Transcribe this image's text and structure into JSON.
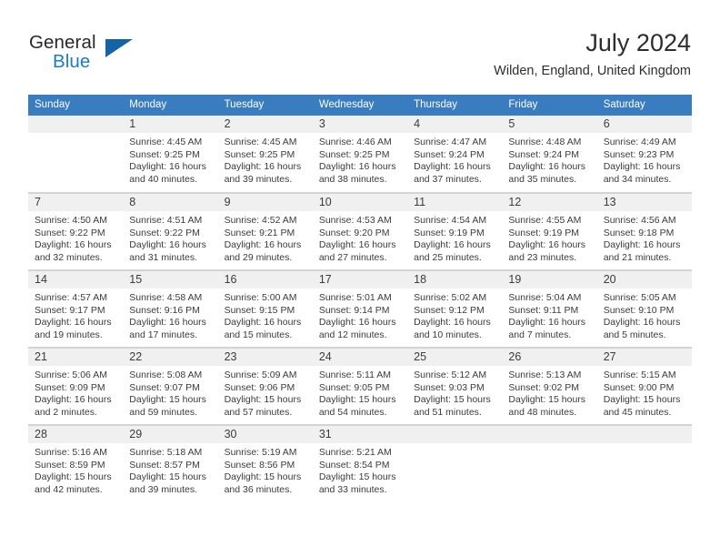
{
  "brand": {
    "line1": "General",
    "line2": "Blue",
    "triangle_color": "#1464a5",
    "blue_color": "#1a7cc4"
  },
  "header": {
    "title": "July 2024",
    "location": "Wilden, England, United Kingdom"
  },
  "theme": {
    "header_bar": "#3a7cc0",
    "daynum_band": "#f0f0f0",
    "grid_line": "#cfd3d6",
    "text": "#3b3b3b"
  },
  "weekdays": [
    "Sunday",
    "Monday",
    "Tuesday",
    "Wednesday",
    "Thursday",
    "Friday",
    "Saturday"
  ],
  "weeks": [
    [
      {
        "day": "",
        "sunrise": "",
        "sunset": "",
        "daylight1": "",
        "daylight2": ""
      },
      {
        "day": "1",
        "sunrise": "Sunrise: 4:45 AM",
        "sunset": "Sunset: 9:25 PM",
        "daylight1": "Daylight: 16 hours",
        "daylight2": "and 40 minutes."
      },
      {
        "day": "2",
        "sunrise": "Sunrise: 4:45 AM",
        "sunset": "Sunset: 9:25 PM",
        "daylight1": "Daylight: 16 hours",
        "daylight2": "and 39 minutes."
      },
      {
        "day": "3",
        "sunrise": "Sunrise: 4:46 AM",
        "sunset": "Sunset: 9:25 PM",
        "daylight1": "Daylight: 16 hours",
        "daylight2": "and 38 minutes."
      },
      {
        "day": "4",
        "sunrise": "Sunrise: 4:47 AM",
        "sunset": "Sunset: 9:24 PM",
        "daylight1": "Daylight: 16 hours",
        "daylight2": "and 37 minutes."
      },
      {
        "day": "5",
        "sunrise": "Sunrise: 4:48 AM",
        "sunset": "Sunset: 9:24 PM",
        "daylight1": "Daylight: 16 hours",
        "daylight2": "and 35 minutes."
      },
      {
        "day": "6",
        "sunrise": "Sunrise: 4:49 AM",
        "sunset": "Sunset: 9:23 PM",
        "daylight1": "Daylight: 16 hours",
        "daylight2": "and 34 minutes."
      }
    ],
    [
      {
        "day": "7",
        "sunrise": "Sunrise: 4:50 AM",
        "sunset": "Sunset: 9:22 PM",
        "daylight1": "Daylight: 16 hours",
        "daylight2": "and 32 minutes."
      },
      {
        "day": "8",
        "sunrise": "Sunrise: 4:51 AM",
        "sunset": "Sunset: 9:22 PM",
        "daylight1": "Daylight: 16 hours",
        "daylight2": "and 31 minutes."
      },
      {
        "day": "9",
        "sunrise": "Sunrise: 4:52 AM",
        "sunset": "Sunset: 9:21 PM",
        "daylight1": "Daylight: 16 hours",
        "daylight2": "and 29 minutes."
      },
      {
        "day": "10",
        "sunrise": "Sunrise: 4:53 AM",
        "sunset": "Sunset: 9:20 PM",
        "daylight1": "Daylight: 16 hours",
        "daylight2": "and 27 minutes."
      },
      {
        "day": "11",
        "sunrise": "Sunrise: 4:54 AM",
        "sunset": "Sunset: 9:19 PM",
        "daylight1": "Daylight: 16 hours",
        "daylight2": "and 25 minutes."
      },
      {
        "day": "12",
        "sunrise": "Sunrise: 4:55 AM",
        "sunset": "Sunset: 9:19 PM",
        "daylight1": "Daylight: 16 hours",
        "daylight2": "and 23 minutes."
      },
      {
        "day": "13",
        "sunrise": "Sunrise: 4:56 AM",
        "sunset": "Sunset: 9:18 PM",
        "daylight1": "Daylight: 16 hours",
        "daylight2": "and 21 minutes."
      }
    ],
    [
      {
        "day": "14",
        "sunrise": "Sunrise: 4:57 AM",
        "sunset": "Sunset: 9:17 PM",
        "daylight1": "Daylight: 16 hours",
        "daylight2": "and 19 minutes."
      },
      {
        "day": "15",
        "sunrise": "Sunrise: 4:58 AM",
        "sunset": "Sunset: 9:16 PM",
        "daylight1": "Daylight: 16 hours",
        "daylight2": "and 17 minutes."
      },
      {
        "day": "16",
        "sunrise": "Sunrise: 5:00 AM",
        "sunset": "Sunset: 9:15 PM",
        "daylight1": "Daylight: 16 hours",
        "daylight2": "and 15 minutes."
      },
      {
        "day": "17",
        "sunrise": "Sunrise: 5:01 AM",
        "sunset": "Sunset: 9:14 PM",
        "daylight1": "Daylight: 16 hours",
        "daylight2": "and 12 minutes."
      },
      {
        "day": "18",
        "sunrise": "Sunrise: 5:02 AM",
        "sunset": "Sunset: 9:12 PM",
        "daylight1": "Daylight: 16 hours",
        "daylight2": "and 10 minutes."
      },
      {
        "day": "19",
        "sunrise": "Sunrise: 5:04 AM",
        "sunset": "Sunset: 9:11 PM",
        "daylight1": "Daylight: 16 hours",
        "daylight2": "and 7 minutes."
      },
      {
        "day": "20",
        "sunrise": "Sunrise: 5:05 AM",
        "sunset": "Sunset: 9:10 PM",
        "daylight1": "Daylight: 16 hours",
        "daylight2": "and 5 minutes."
      }
    ],
    [
      {
        "day": "21",
        "sunrise": "Sunrise: 5:06 AM",
        "sunset": "Sunset: 9:09 PM",
        "daylight1": "Daylight: 16 hours",
        "daylight2": "and 2 minutes."
      },
      {
        "day": "22",
        "sunrise": "Sunrise: 5:08 AM",
        "sunset": "Sunset: 9:07 PM",
        "daylight1": "Daylight: 15 hours",
        "daylight2": "and 59 minutes."
      },
      {
        "day": "23",
        "sunrise": "Sunrise: 5:09 AM",
        "sunset": "Sunset: 9:06 PM",
        "daylight1": "Daylight: 15 hours",
        "daylight2": "and 57 minutes."
      },
      {
        "day": "24",
        "sunrise": "Sunrise: 5:11 AM",
        "sunset": "Sunset: 9:05 PM",
        "daylight1": "Daylight: 15 hours",
        "daylight2": "and 54 minutes."
      },
      {
        "day": "25",
        "sunrise": "Sunrise: 5:12 AM",
        "sunset": "Sunset: 9:03 PM",
        "daylight1": "Daylight: 15 hours",
        "daylight2": "and 51 minutes."
      },
      {
        "day": "26",
        "sunrise": "Sunrise: 5:13 AM",
        "sunset": "Sunset: 9:02 PM",
        "daylight1": "Daylight: 15 hours",
        "daylight2": "and 48 minutes."
      },
      {
        "day": "27",
        "sunrise": "Sunrise: 5:15 AM",
        "sunset": "Sunset: 9:00 PM",
        "daylight1": "Daylight: 15 hours",
        "daylight2": "and 45 minutes."
      }
    ],
    [
      {
        "day": "28",
        "sunrise": "Sunrise: 5:16 AM",
        "sunset": "Sunset: 8:59 PM",
        "daylight1": "Daylight: 15 hours",
        "daylight2": "and 42 minutes."
      },
      {
        "day": "29",
        "sunrise": "Sunrise: 5:18 AM",
        "sunset": "Sunset: 8:57 PM",
        "daylight1": "Daylight: 15 hours",
        "daylight2": "and 39 minutes."
      },
      {
        "day": "30",
        "sunrise": "Sunrise: 5:19 AM",
        "sunset": "Sunset: 8:56 PM",
        "daylight1": "Daylight: 15 hours",
        "daylight2": "and 36 minutes."
      },
      {
        "day": "31",
        "sunrise": "Sunrise: 5:21 AM",
        "sunset": "Sunset: 8:54 PM",
        "daylight1": "Daylight: 15 hours",
        "daylight2": "and 33 minutes."
      },
      {
        "day": "",
        "sunrise": "",
        "sunset": "",
        "daylight1": "",
        "daylight2": ""
      },
      {
        "day": "",
        "sunrise": "",
        "sunset": "",
        "daylight1": "",
        "daylight2": ""
      },
      {
        "day": "",
        "sunrise": "",
        "sunset": "",
        "daylight1": "",
        "daylight2": ""
      }
    ]
  ]
}
